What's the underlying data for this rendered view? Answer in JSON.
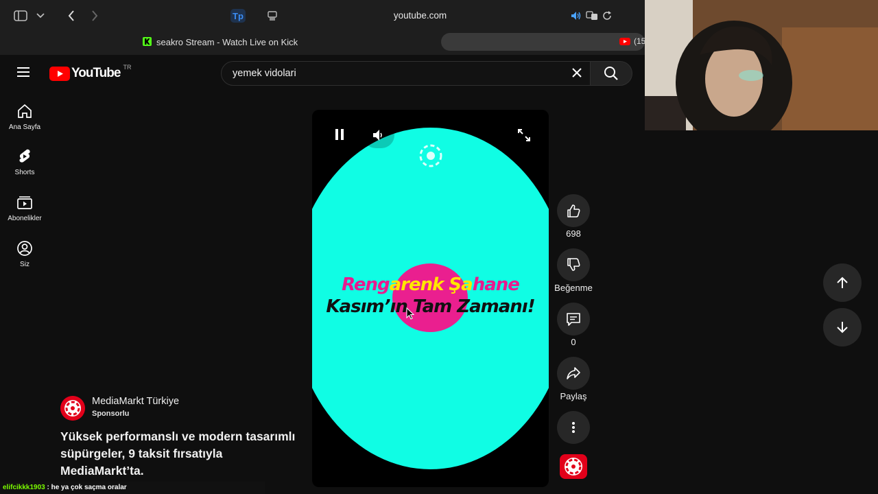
{
  "browser": {
    "url": "youtube.com",
    "tab_left_title": "seakro Stream - Watch Live on Kick",
    "tab_right_badge": "(15"
  },
  "youtube": {
    "logo_text": "YouTube",
    "region": "TR",
    "search_value": "yemek vidolari",
    "nav": [
      {
        "label": "Ana Sayfa"
      },
      {
        "label": "Shorts"
      },
      {
        "label": "Abonelikler"
      },
      {
        "label": "Siz"
      }
    ]
  },
  "player": {
    "promo_line1_a": "Reng",
    "promo_line1_b": "arenk Şa",
    "promo_line1_c": "hane",
    "promo_line2": "Kasım’ın Tam Zamanı!"
  },
  "actions": {
    "like_count": "698",
    "dislike_label": "Beğenme",
    "comment_count": "0",
    "share_label": "Paylaş"
  },
  "video": {
    "channel_name": "MediaMarkt Türkiye",
    "sponsored_label": "Sponsorlu",
    "title": "Yüksek performanslı ve modern tasarımlı süpürgeler, 9 taksit fırsatıyla MediaMarkt’ta."
  },
  "chat": {
    "user": "elifcikkk1903",
    "message": " : he ya çok saçma oralar"
  },
  "colors": {
    "brand_red": "#ff0000",
    "promo_teal": "#10fde4",
    "promo_pink": "#ea1f8f",
    "kick_green": "#53fc18"
  }
}
